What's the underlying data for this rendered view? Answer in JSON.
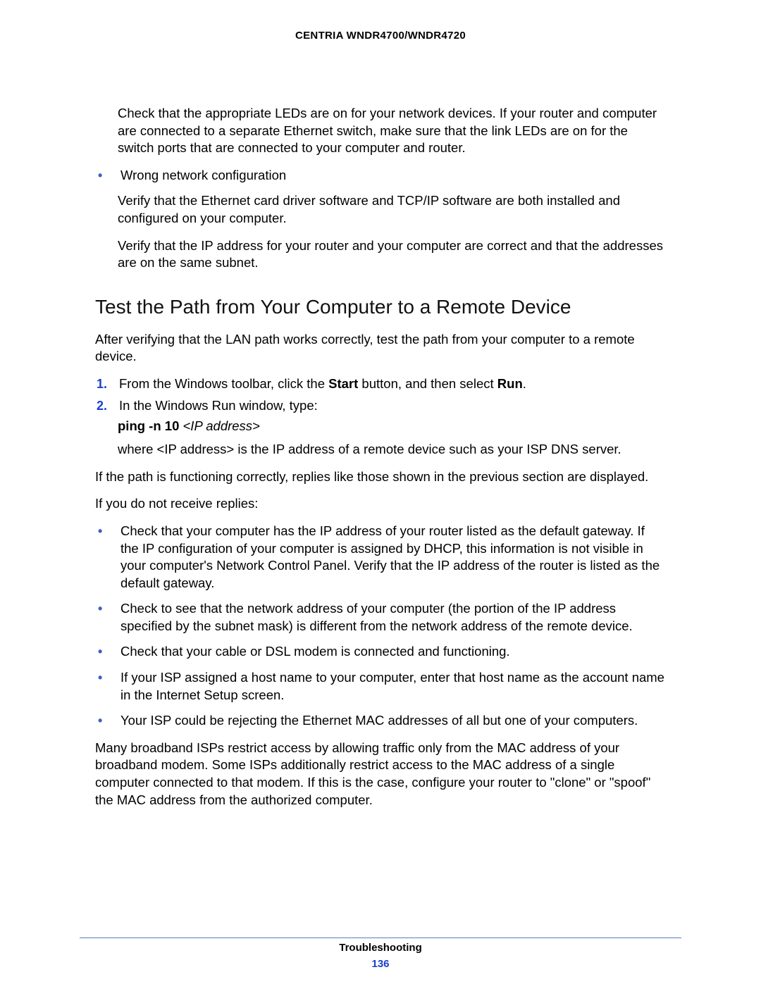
{
  "header": {
    "title": "CENTRIA WNDR4700/WNDR4720"
  },
  "intro": {
    "p1": "Check that the appropriate LEDs are on for your network devices. If your router and computer are connected to a separate Ethernet switch, make sure that the link LEDs are on for the switch ports that are connected to your computer and router.",
    "bullet_label": "Wrong network configuration",
    "p2": "Verify that the Ethernet card driver software and TCP/IP software are both installed and configured on your computer.",
    "p3": "Verify that the IP address for your router and your computer are correct and that the addresses are on the same subnet."
  },
  "section": {
    "title": "Test the Path from Your Computer to a Remote Device",
    "after": "After verifying that the LAN path works correctly, test the path from your computer to a remote device.",
    "step1": {
      "num": "1.",
      "pre": "From the Windows toolbar, click the ",
      "start": "Start",
      "mid": " button, and then select ",
      "run": "Run",
      "post": "."
    },
    "step2": {
      "num": "2.",
      "text": "In the Windows Run window, type:"
    },
    "cmd": {
      "bold": "ping -n 10 ",
      "ital": "<IP address>"
    },
    "where": "where <IP address> is the IP address of a remote device such as your ISP DNS server.",
    "func": "If the path is functioning correctly, replies like those shown in the previous section are displayed.",
    "noreply": "If you do not receive replies:",
    "bullets": [
      "Check that your computer has the IP address of your router listed as the default gateway. If the IP configuration of your computer is assigned by DHCP, this information is not visible in your computer's Network Control Panel. Verify that the IP address of the router is listed as the default gateway.",
      "Check to see that the network address of your computer (the portion of the IP address specified by the subnet mask) is different from the network address of the remote device.",
      "Check that your cable or DSL modem is connected and functioning.",
      "If your ISP assigned a host name to your computer, enter that host name as the account name in the Internet Setup screen.",
      "Your ISP could be rejecting the Ethernet MAC addresses of all but one of your computers."
    ],
    "closing": "Many broadband ISPs restrict access by allowing traffic only from the MAC address of your broadband modem. Some ISPs additionally restrict access to the MAC address of a single computer connected to that modem. If this is the case, configure your router to \"clone\" or \"spoof\" the MAC address from the authorized computer."
  },
  "footer": {
    "title": "Troubleshooting",
    "page": "136"
  },
  "bullet_glyph": "•"
}
